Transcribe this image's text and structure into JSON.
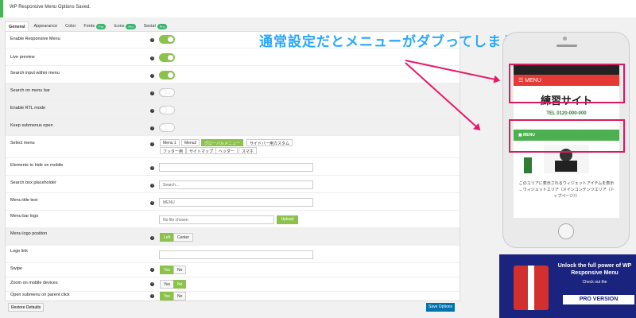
{
  "notice": "WP Responsive Menu Options Saved.",
  "tabs": [
    {
      "label": "General"
    },
    {
      "label": "Appearance"
    },
    {
      "label": "Color"
    },
    {
      "label": "Fonts",
      "badge": "Pro"
    },
    {
      "label": "Icons",
      "badge": "Pro"
    },
    {
      "label": "Social",
      "badge": "Pro"
    }
  ],
  "settings": {
    "enable_menu": "Enable Responsive Menu",
    "live_preview": "Live preview",
    "search_input": "Search input within menu",
    "search_bar": "Search on menu bar",
    "rtl": "Enable RTL mode",
    "keep_submenus": "Keep submenus open",
    "select_menu": "Select menu",
    "hide_elements": "Elements to hide on mobile",
    "search_placeholder": "Search box placeholder",
    "menu_title": "Menu title text",
    "menu_logo": "Menu bar logo",
    "logo_position": "Menu logo position",
    "logo_link": "Logo link",
    "swipe": "Swipe",
    "zoom": "Zoom on mobile devices",
    "open_submenu": "Open submenu on parent click"
  },
  "menus": [
    "Menu 1",
    "Menu2",
    "グローバルメニュー",
    "サイドバー用カスタム",
    "フッター用",
    "サイトマップ",
    "ヘッダー",
    "スマホ"
  ],
  "inputs": {
    "search_placeholder": "Search...",
    "menu_title": "MENU",
    "logo": "No file chosen"
  },
  "buttons": {
    "upload": "Upload",
    "left": "Left",
    "center": "Center",
    "yes": "Yes",
    "no": "No",
    "restore": "Restore Defaults",
    "save": "Save Options"
  },
  "annotation": "通常設定だとメニューがダブってしまう！",
  "phone": {
    "menu": "MENU",
    "site": "練習サイト",
    "phone": "TEL 0120-000-000",
    "green": "MENU",
    "text": "このエリアに表示されるウィジェットアイテムを表示 ... ウィジェットエリア（メインコンテンツエリア（トップページ））"
  },
  "promo": {
    "title": "Unlock the full power of WP Responsive Menu",
    "sub": "Check out the",
    "pro": "PRO VERSION"
  },
  "colors": {
    "accent": "#8bc34a",
    "save": "#0073aa",
    "annotation": "#2aa7ff",
    "highlight": "#d81b60"
  }
}
